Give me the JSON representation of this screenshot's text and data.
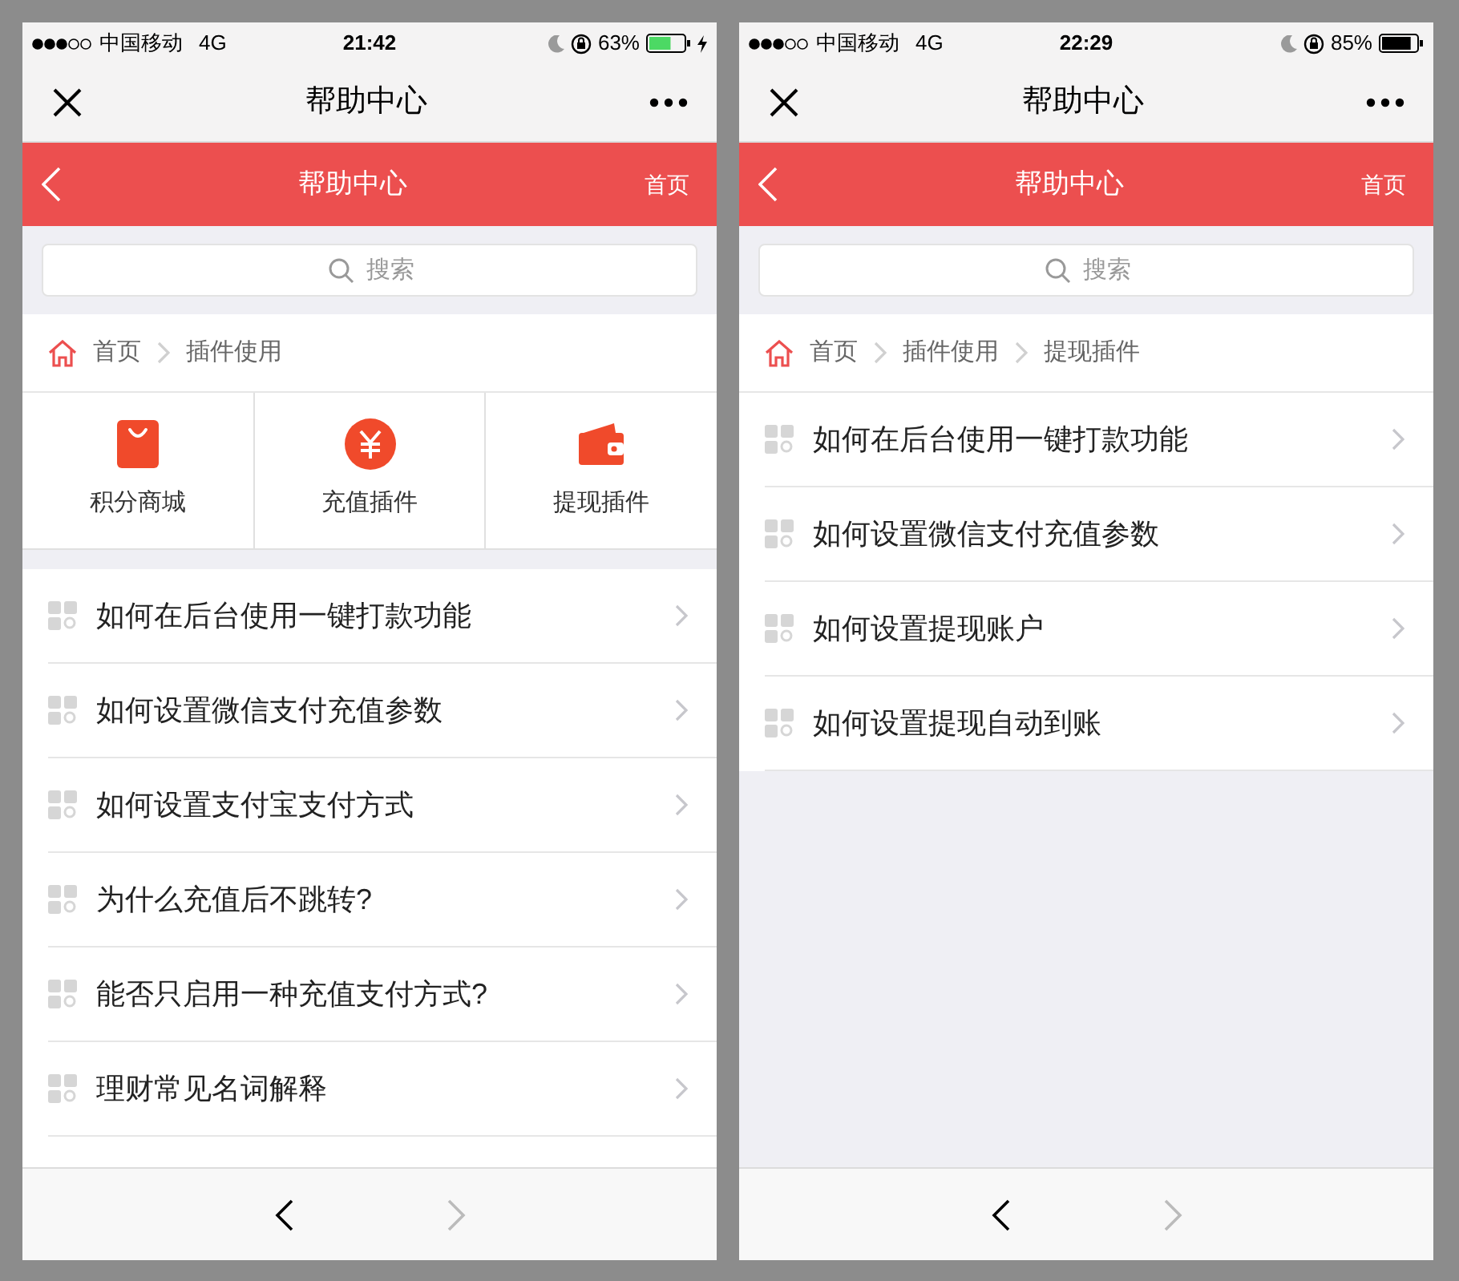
{
  "phones": [
    {
      "status_bar": {
        "carrier": "中国移动",
        "network": "4G",
        "time": "21:42",
        "battery": "63%",
        "charging": true
      },
      "nav_title": "帮助中心",
      "header": {
        "title": "帮助中心",
        "home": "首页"
      },
      "search": {
        "placeholder": "搜索"
      },
      "breadcrumb": [
        {
          "label": "首页"
        },
        {
          "label": "插件使用"
        }
      ],
      "categories": [
        {
          "label": "积分商城"
        },
        {
          "label": "充值插件"
        },
        {
          "label": "提现插件"
        }
      ],
      "articles": [
        {
          "title": "如何在后台使用一键打款功能"
        },
        {
          "title": "如何设置微信支付充值参数"
        },
        {
          "title": "如何设置支付宝支付方式"
        },
        {
          "title": "为什么充值后不跳转?"
        },
        {
          "title": "能否只启用一种充值支付方式?"
        },
        {
          "title": "理财常见名词解释"
        }
      ],
      "toolbar": {
        "back_disabled": false,
        "forward_disabled": true
      }
    },
    {
      "status_bar": {
        "carrier": "中国移动",
        "network": "4G",
        "time": "22:29",
        "battery": "85%",
        "charging": false
      },
      "nav_title": "帮助中心",
      "header": {
        "title": "帮助中心",
        "home": "首页"
      },
      "search": {
        "placeholder": "搜索"
      },
      "breadcrumb": [
        {
          "label": "首页"
        },
        {
          "label": "插件使用"
        },
        {
          "label": "提现插件"
        }
      ],
      "articles": [
        {
          "title": "如何在后台使用一键打款功能"
        },
        {
          "title": "如何设置微信支付充值参数"
        },
        {
          "title": "如何设置提现账户"
        },
        {
          "title": "如何设置提现自动到账"
        }
      ],
      "toolbar": {
        "back_disabled": false,
        "forward_disabled": true
      }
    }
  ]
}
